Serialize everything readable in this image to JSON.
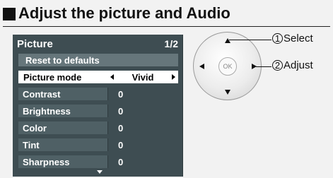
{
  "title": "Adjust the picture and Audio",
  "menu": {
    "header": "Picture",
    "page": "1/2",
    "reset_label": "Reset to defaults",
    "selected": {
      "label": "Picture mode",
      "value": "Vivid"
    },
    "items": [
      {
        "label": "Contrast",
        "value": "0"
      },
      {
        "label": "Brightness",
        "value": "0"
      },
      {
        "label": "Color",
        "value": "0"
      },
      {
        "label": "Tint",
        "value": "0"
      },
      {
        "label": "Sharpness",
        "value": "0"
      }
    ]
  },
  "remote": {
    "ok_label": "OK",
    "callout_select": {
      "num": "1",
      "text": "Select"
    },
    "callout_adjust": {
      "num": "2",
      "text": "Adjust"
    }
  }
}
